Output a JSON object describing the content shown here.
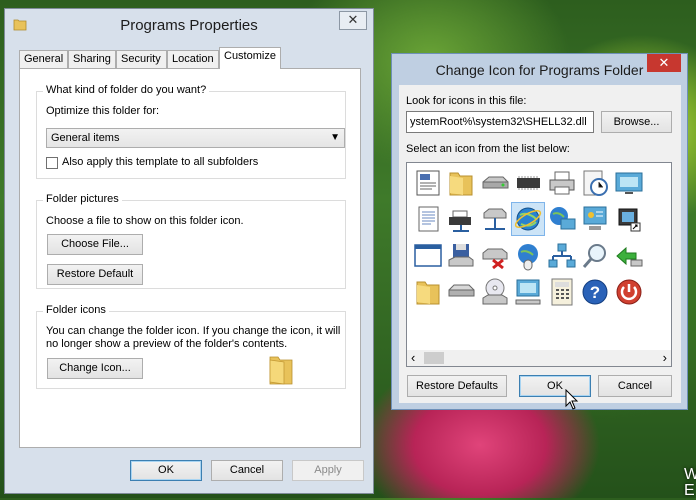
{
  "desktop": {
    "side_text_1": "W",
    "side_text_2": "E"
  },
  "properties_window": {
    "title": "Programs Properties",
    "close_glyph": "✕",
    "tabs": [
      {
        "label": "General"
      },
      {
        "label": "Sharing"
      },
      {
        "label": "Security"
      },
      {
        "label": "Location"
      },
      {
        "label": "Customize"
      }
    ],
    "active_tab": "Customize",
    "folder_type_group": {
      "heading": "What kind of folder do you want?",
      "optimize_label": "Optimize this folder for:",
      "optimize_value": "General items",
      "apply_subfolders_label": "Also apply this template to all subfolders",
      "apply_subfolders_checked": false
    },
    "folder_pictures_group": {
      "heading": "Folder pictures",
      "description": "Choose a file to show on this folder icon.",
      "choose_file_button": "Choose File...",
      "restore_default_button": "Restore Default"
    },
    "folder_icons_group": {
      "heading": "Folder icons",
      "description_line1": "You can change the folder icon. If you change the icon, it will",
      "description_line2": "no longer show a preview of the folder's contents.",
      "change_icon_button": "Change Icon..."
    },
    "footer": {
      "ok": "OK",
      "cancel": "Cancel",
      "apply": "Apply"
    }
  },
  "change_icon_dialog": {
    "title": "Change Icon for Programs Folder",
    "close_glyph": "✕",
    "look_for_label": "Look for icons in this file:",
    "file_path": "ystemRoot%\\system32\\SHELL32.dll",
    "browse_button": "Browse...",
    "select_label": "Select an icon from the list below:",
    "selected_icon": "internet-globe-icon",
    "footer": {
      "restore_defaults": "Restore Defaults",
      "ok": "OK",
      "cancel": "Cancel"
    },
    "scroll_left": "‹",
    "scroll_right": "›",
    "icons": [
      [
        "document-list-icon",
        "folder-icon",
        "drive-icon",
        "memory-chip-icon",
        "printer-icon",
        "clock-doc-icon",
        "monitor-icon"
      ],
      [
        "text-document-icon",
        "network-printer-icon",
        "network-drive-icon",
        "internet-globe-icon",
        "globe-monitor-icon",
        "control-panel-icon",
        "shortcut-icon"
      ],
      [
        "window-icon",
        "floppy-disk-icon",
        "disconnected-drive-icon",
        "mouse-globe-icon",
        "network-icon",
        "search-icon",
        "arrow-icon"
      ],
      [
        "folder-icon",
        "disk-drive-icon",
        "cd-drive-icon",
        "computer-icon",
        "calculator-icon",
        "help-icon",
        "power-icon"
      ]
    ],
    "colors": {
      "titlebar": "#bfcfe2",
      "close_button": "#c7372f",
      "selection": "#cce4f7"
    }
  }
}
